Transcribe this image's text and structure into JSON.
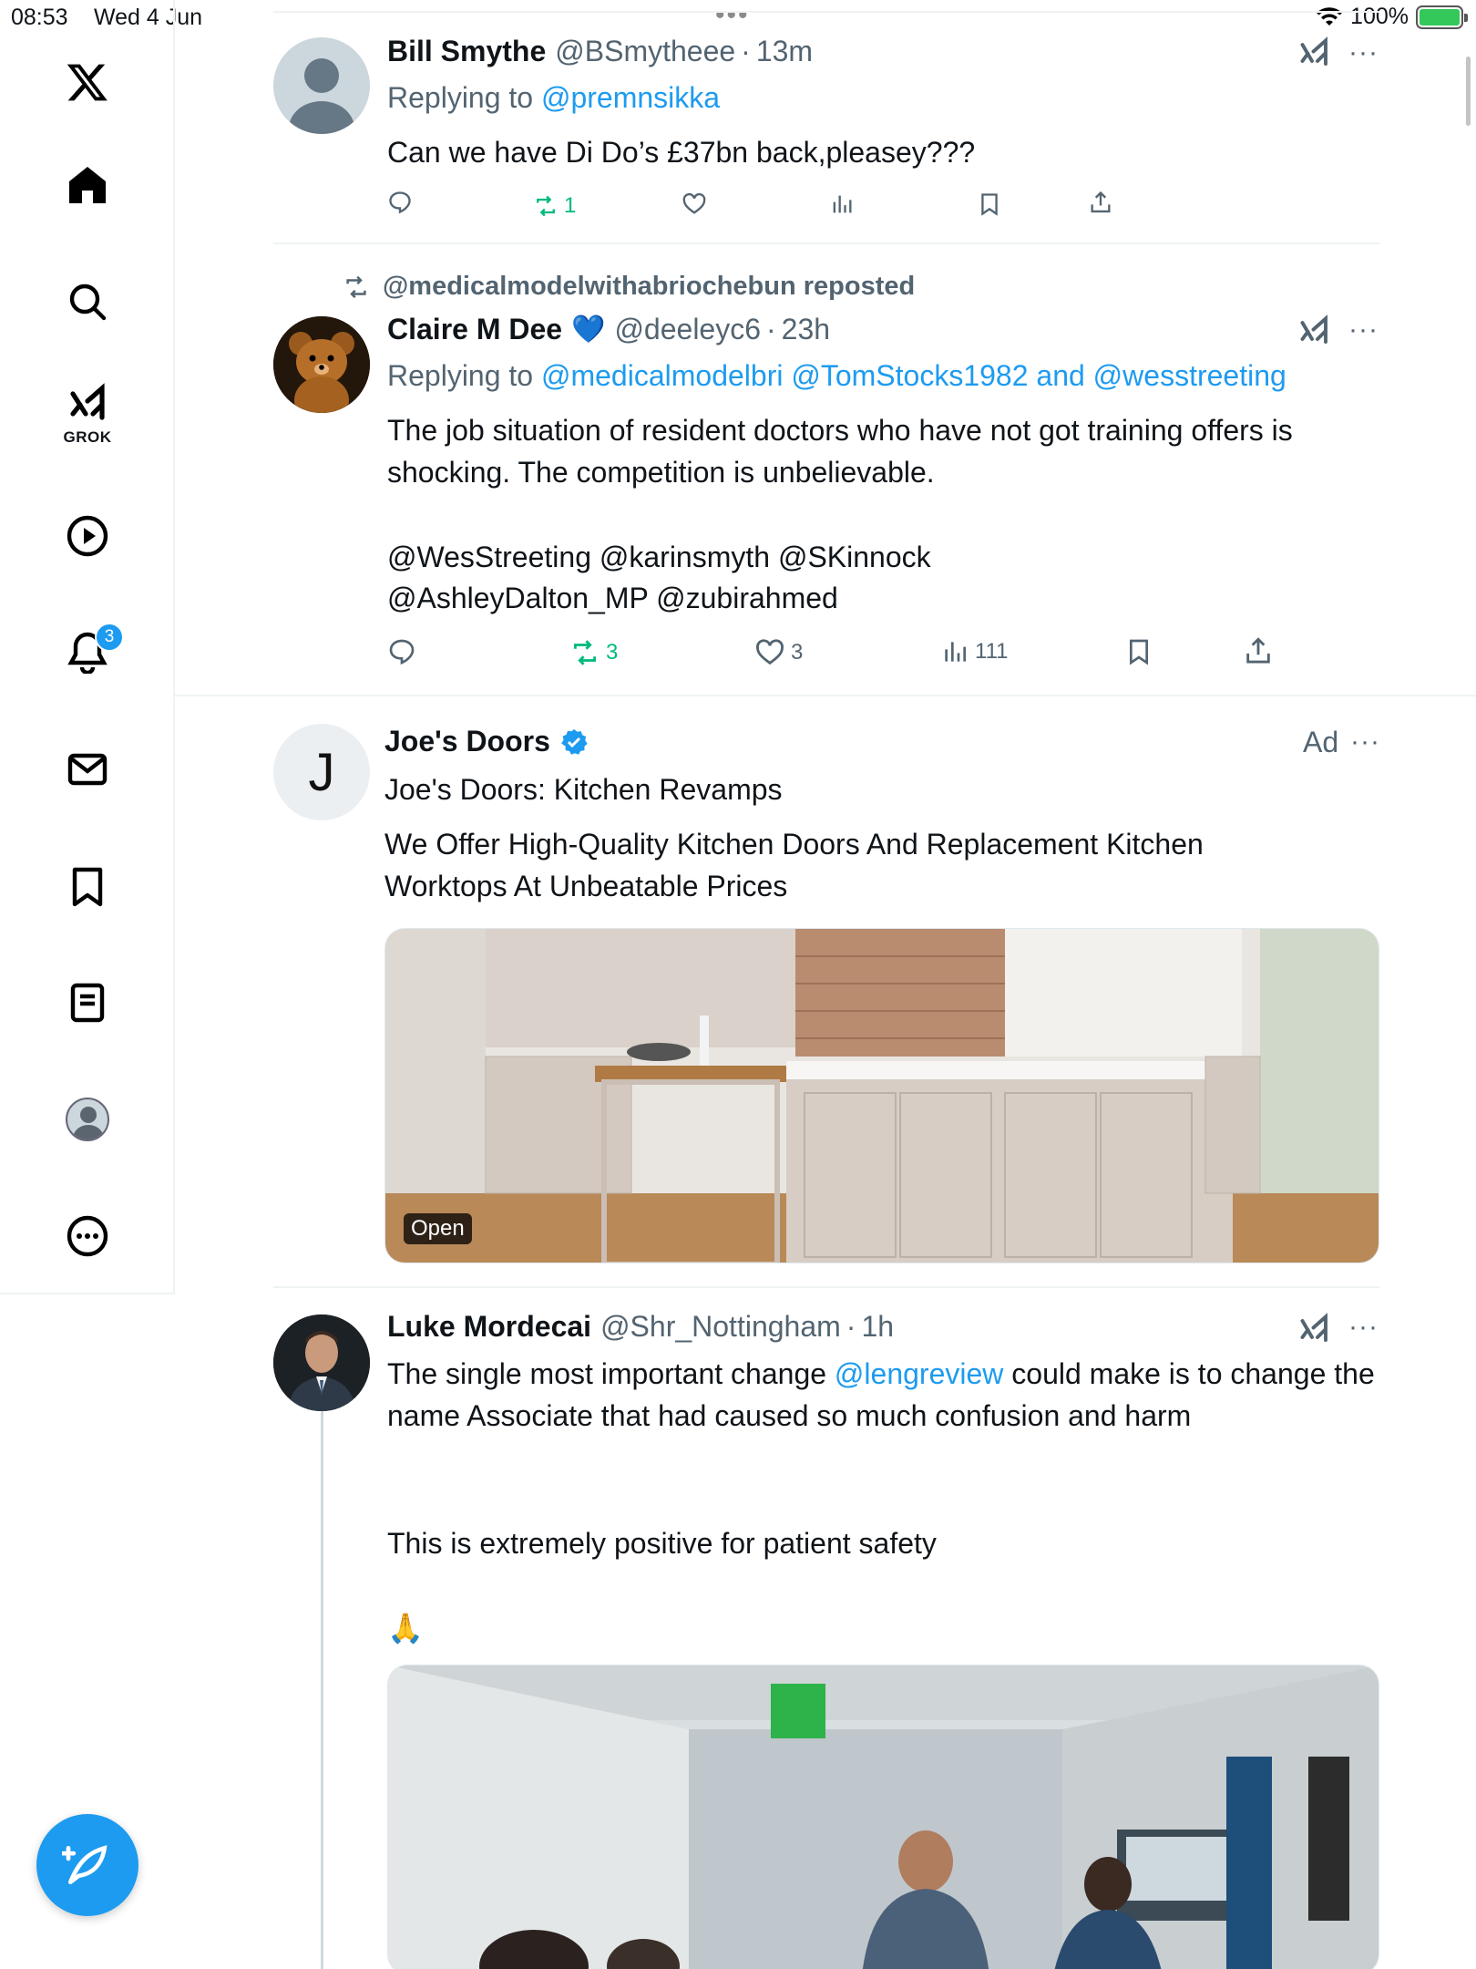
{
  "status_bar": {
    "time": "08:53",
    "date": "Wed 4 Jun",
    "battery": "100%"
  },
  "sidebar": {
    "grok_label": "GROK",
    "notifications_count": "3"
  },
  "tweets": [
    {
      "name": "Bill Smythe",
      "handle": "@BSmytheee",
      "time": "13m",
      "replying_prefix": "Replying to ",
      "replying_to": "@premnsikka",
      "text": "Can we have Di Do’s £37bn back,pleasey???",
      "reposts": "1"
    },
    {
      "repost_note": "@medicalmodelwithabriochebun reposted",
      "name": "Claire M Dee",
      "name_emoji": "💙",
      "handle": "@deeleyc6",
      "time": "23h",
      "replying_prefix": "Replying to ",
      "replying_to": "@medicalmodelbri @TomStocks1982",
      "replying_and": " and ",
      "replying_to_2": "@wesstreeting",
      "text": "The job situation of resident doctors who have not got training offers is shocking. The competition is unbelievable.",
      "mentions_line1": "@WesStreeting @karinsmyth @SKinnock",
      "mentions_line2": "@AshleyDalton_MP @zubirahmed",
      "reposts": "3",
      "likes": "3",
      "views": "111"
    },
    {
      "name": "Joe's Doors",
      "avatar_letter": "J",
      "ad_label": "Ad",
      "headline": "Joe's Doors: Kitchen Revamps",
      "text": "We Offer High-Quality Kitchen Doors And Replacement Kitchen Worktops At Unbeatable Prices",
      "media_label": "Open"
    },
    {
      "name": "Luke Mordecai",
      "handle": "@Shr_Nottingham",
      "time": "1h",
      "text_prefix": "The single most important change ",
      "mention": "@lengreview",
      "text_suffix": " could make is to change the name Associate that had caused so much confusion and harm",
      "text_2": "This is extremely positive for patient safety",
      "emoji": "🙏"
    }
  ],
  "separator_dot": "·",
  "more_glyph": "···",
  "colors": {
    "accent": "#1d9bf0",
    "repost_green": "#00ba7c",
    "secondary_text": "#536471"
  }
}
